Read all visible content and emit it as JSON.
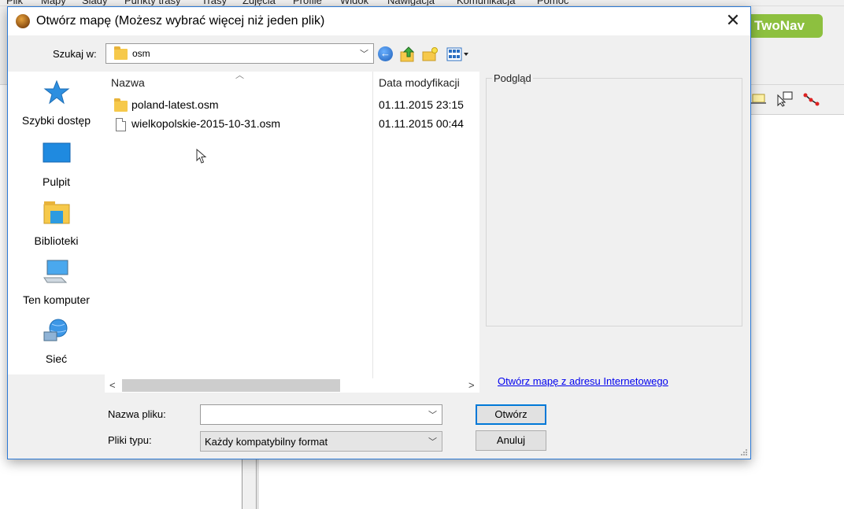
{
  "background_app": {
    "menu_items": [
      "Plik",
      "Mapy",
      "Ślady",
      "Punkty trasy",
      "Trasy",
      "Zdjęcia",
      "Profile",
      "Widok",
      "Nawigacja",
      "Komunikacja",
      "Pomoc"
    ],
    "brand": "TwoNav"
  },
  "dialog": {
    "title": "Otwórz mapę (Możesz wybrać więcej niż jeden plik)",
    "close_glyph": "✕",
    "look_in": {
      "label": "Szukaj w:",
      "value": "osm"
    },
    "places": [
      {
        "label": "Szybki dostęp",
        "icon": "star-icon"
      },
      {
        "label": "Pulpit",
        "icon": "desktop-icon"
      },
      {
        "label": "Biblioteki",
        "icon": "library-icon"
      },
      {
        "label": "Ten komputer",
        "icon": "computer-icon"
      },
      {
        "label": "Sieć",
        "icon": "network-icon"
      }
    ],
    "columns": {
      "name": "Nazwa",
      "modified": "Data modyfikacji"
    },
    "files": [
      {
        "name": "poland-latest.osm",
        "date": "01.11.2015 23:15",
        "type": "folder"
      },
      {
        "name": "wielkopolskie-2015-10-31.osm",
        "date": "01.11.2015 00:44",
        "type": "file"
      }
    ],
    "preview_label": "Podgląd",
    "internet_link": "Otwórz mapę z adresu Internetowego",
    "file_name": {
      "label": "Nazwa pliku:",
      "value": ""
    },
    "file_type": {
      "label": "Pliki typu:",
      "value": "Każdy kompatybilny format"
    },
    "open_button": "Otwórz",
    "cancel_button": "Anuluj"
  },
  "colors": {
    "accent": "#0078d7",
    "brand_green": "#8dc03f",
    "link": "#0000ee"
  }
}
